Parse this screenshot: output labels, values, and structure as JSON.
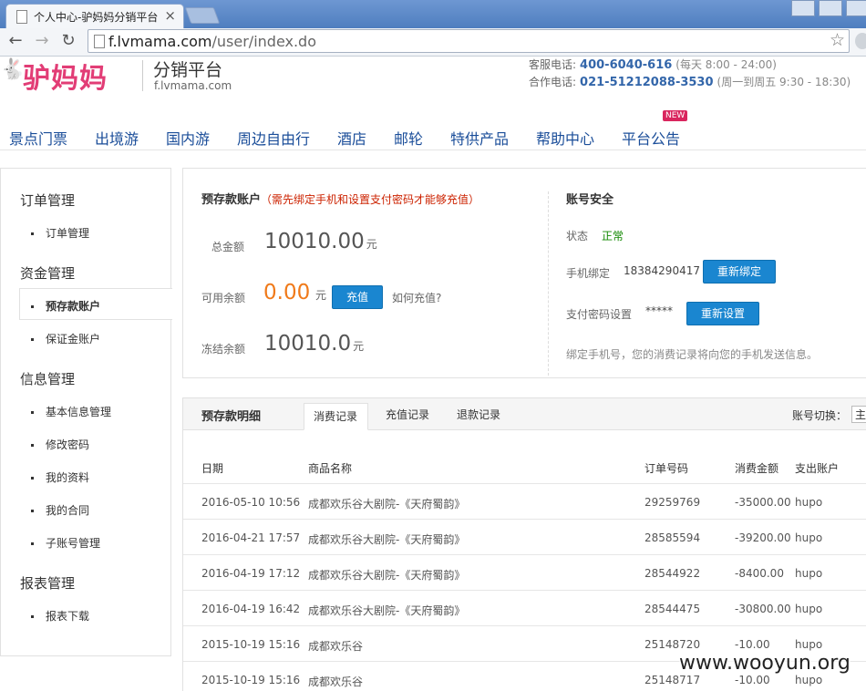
{
  "browser": {
    "tab_title": "个人中心-驴妈妈分销平台",
    "tab_close": "×",
    "url_host": "f.lvmama.com",
    "url_path": "/user/index.do",
    "back": "←",
    "forward": "→",
    "reload": "↻",
    "star": "☆"
  },
  "header": {
    "logo_text": "驴妈妈",
    "subtitle": "分销平台",
    "domain": "f.lvmama.com",
    "service_label": "客服电话:",
    "service_phone": "400-6040-616",
    "service_hours": "(每天   8:00 - 24:00)",
    "coop_label": "合作电话:",
    "coop_phone": "021-51212088-3530",
    "coop_hours": "(周一到周五   9:30 - 18:30)"
  },
  "nav": {
    "items": [
      "景点门票",
      "出境游",
      "国内游",
      "周边自由行",
      "酒店",
      "邮轮",
      "特供产品",
      "帮助中心",
      "平台公告"
    ],
    "badge": "NEW"
  },
  "sidebar": {
    "groups": [
      {
        "title": "订单管理",
        "items": [
          "订单管理"
        ]
      },
      {
        "title": "资金管理",
        "items": [
          "预存款账户",
          "保证金账户"
        ]
      },
      {
        "title": "信息管理",
        "items": [
          "基本信息管理",
          "修改密码",
          "我的资料",
          "我的合同",
          "子账号管理"
        ]
      },
      {
        "title": "报表管理",
        "items": [
          "报表下载"
        ]
      }
    ]
  },
  "account": {
    "title": "预存款账户",
    "warning": "（需先绑定手机和设置支付密码才能够充值）",
    "total_label": "总金额",
    "total_value": "10010.00",
    "unit": "元",
    "available_label": "可用余额",
    "available_value": "0.00",
    "available_unit": " 元",
    "recharge_button": "充值",
    "how_link": "如何充值?",
    "frozen_label": "冻结余额",
    "frozen_value": "10010.0"
  },
  "security": {
    "title": "账号安全",
    "status_label": "状态",
    "status_value": "正常",
    "phone_label": "手机绑定",
    "phone_value": "18384290417",
    "rebind_button": "重新绑定",
    "pwd_label": "支付密码设置",
    "pwd_value": "*****",
    "reset_button": "重新设置",
    "note": "绑定手机号，您的消费记录将向您的手机发送信息。"
  },
  "detail": {
    "title": "预存款明细",
    "tabs": [
      "消费记录",
      "充值记录",
      "退款记录"
    ],
    "switch_label": "账号切换：",
    "switch_value": "主",
    "columns": [
      "日期",
      "商品名称",
      "订单号码",
      "消费金额",
      "支出账户"
    ],
    "rows": [
      [
        "2016-05-10 10:56",
        "成都欢乐谷大剧院-《天府蜀韵》",
        "29259769",
        "-35000.00",
        "hupo"
      ],
      [
        "2016-04-21 17:57",
        "成都欢乐谷大剧院-《天府蜀韵》",
        "28585594",
        "-39200.00",
        "hupo"
      ],
      [
        "2016-04-19 17:12",
        "成都欢乐谷大剧院-《天府蜀韵》",
        "28544922",
        "-8400.00",
        "hupo"
      ],
      [
        "2016-04-19 16:42",
        "成都欢乐谷大剧院-《天府蜀韵》",
        "28544475",
        "-30800.00",
        "hupo"
      ],
      [
        "2015-10-19 15:16",
        "成都欢乐谷",
        "25148720",
        "-10.00",
        "hupo"
      ],
      [
        "2015-10-19 15:16",
        "成都欢乐谷",
        "25148717",
        "-10.00",
        "hupo"
      ]
    ]
  },
  "watermark": "www.wooyun.org"
}
